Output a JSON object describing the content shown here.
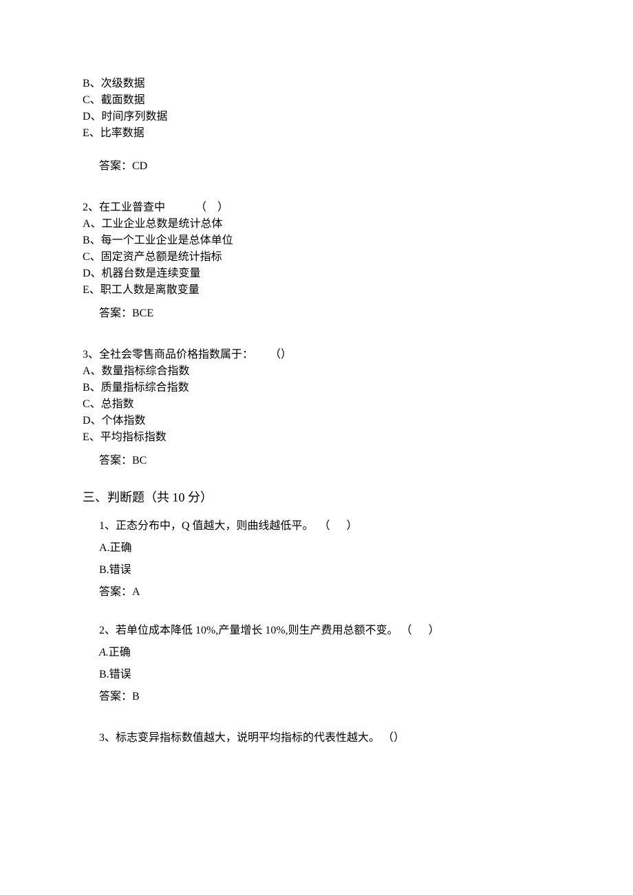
{
  "q1": {
    "options": {
      "B": "B、次级数据",
      "C": "C、截面数据",
      "D": "D、时间序列数据",
      "E": "E、比率数据"
    },
    "answer_label": "答案：CD"
  },
  "q2": {
    "stem": "2、在工业普查中           （    ）",
    "options": {
      "A": "A、工业企业总数是统计总体",
      "B": "B、每一个工业企业是总体单位",
      "C": "C、固定资产总额是统计指标",
      "D": "D、机器台数是连续变量",
      "E": "E、职工人数是离散变量"
    },
    "answer_label": "答案：BCE"
  },
  "q3": {
    "stem": "3、全社会零售商品价格指数属于：      （）",
    "options": {
      "A": "A、数量指标综合指数",
      "B": "B、质量指标综合指数",
      "C": "C、总指数",
      "D": "D、个体指数",
      "E": "E、平均指标指数"
    },
    "answer_label": "答案：BC"
  },
  "section3_heading": "三、判断题（共 10 分）",
  "tf1": {
    "stem": "1、正态分布中，Q 值越大，则曲线越低平。  （      ）",
    "A": "A.正确",
    "B": "B.错误",
    "answer_label": "答案：A"
  },
  "tf2": {
    "stem": "2、若单位成本降低 10%,产量增长 10%,则生产费用总额不变。 （      ）",
    "A": "A.正确",
    "A_prefix": "A.",
    "A_text": "正确",
    "B": "B.错误",
    "answer_label": "答案：B"
  },
  "tf3": {
    "stem": "3、标志变异指标数值越大，说明平均指标的代表性越大。 （）"
  }
}
